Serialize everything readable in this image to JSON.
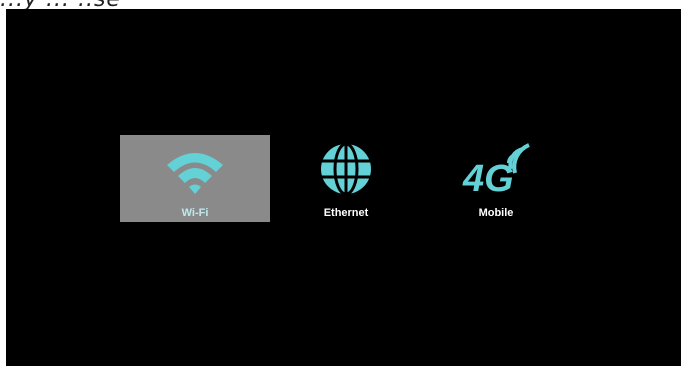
{
  "top_fragment": "...y ... ..se",
  "accent_color": "#63d1d6",
  "network_options": [
    {
      "id": "wifi",
      "label": "Wi-Fi",
      "icon": "wifi-icon",
      "selected": true
    },
    {
      "id": "ethernet",
      "label": "Ethernet",
      "icon": "globe-icon",
      "selected": false
    },
    {
      "id": "mobile",
      "label": "Mobile",
      "icon": "4g-icon",
      "selected": false
    }
  ]
}
